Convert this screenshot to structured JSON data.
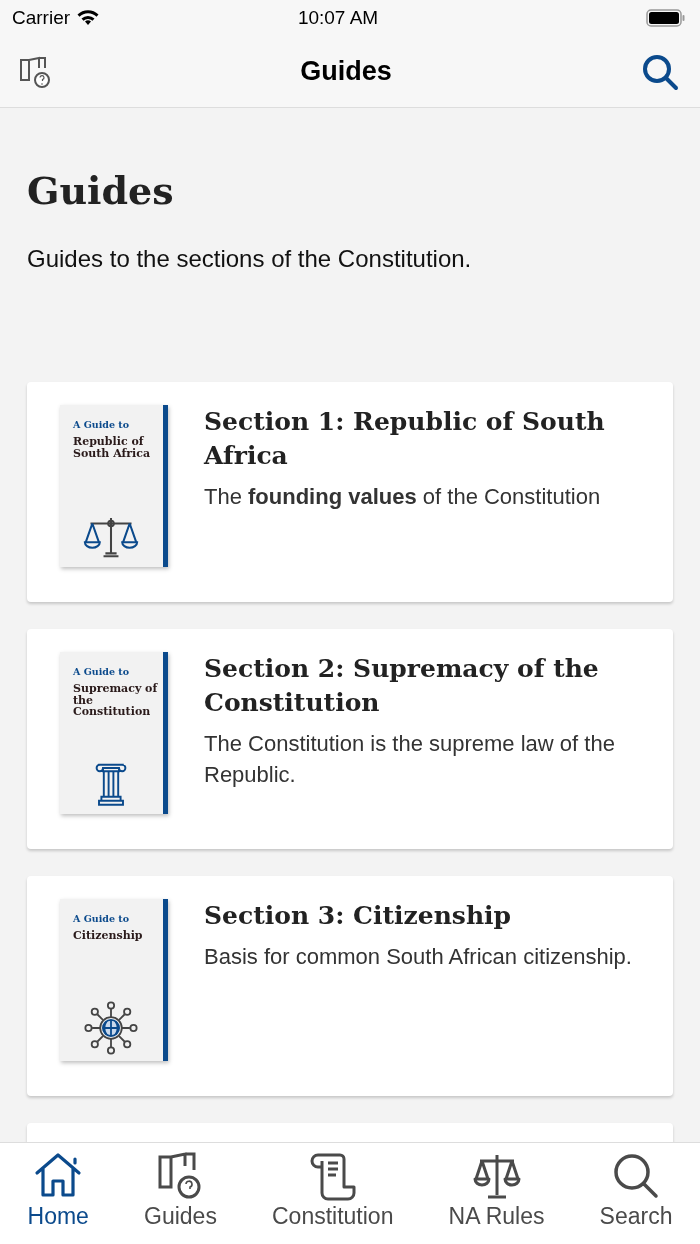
{
  "status_bar": {
    "carrier": "Carrier",
    "time": "10:07 AM"
  },
  "nav_bar": {
    "title": "Guides"
  },
  "header": {
    "title": "Guides",
    "subtitle": "Guides to the sections of the Constitution."
  },
  "guides": [
    {
      "cover_label": "A Guide to",
      "cover_title": "Republic of South Africa",
      "title": "Section 1: Republic of South Africa",
      "description": "The **founding values** of the Constitution"
    },
    {
      "cover_label": "A Guide to",
      "cover_title": "Supremacy of the Constitution",
      "title": "Section 2: Supremacy of the Constitution",
      "description": "The Constitution is the supreme law of the Republic."
    },
    {
      "cover_label": "A Guide to",
      "cover_title": "Citizenship",
      "title": "Section 3: Citizenship",
      "description": "Basis for common South African citizenship."
    }
  ],
  "tabs": [
    {
      "label": "Home",
      "selected": true
    },
    {
      "label": "Guides",
      "selected": false
    },
    {
      "label": "Constitution",
      "selected": false
    },
    {
      "label": "NA Rules",
      "selected": false
    },
    {
      "label": "Search",
      "selected": false
    }
  ]
}
